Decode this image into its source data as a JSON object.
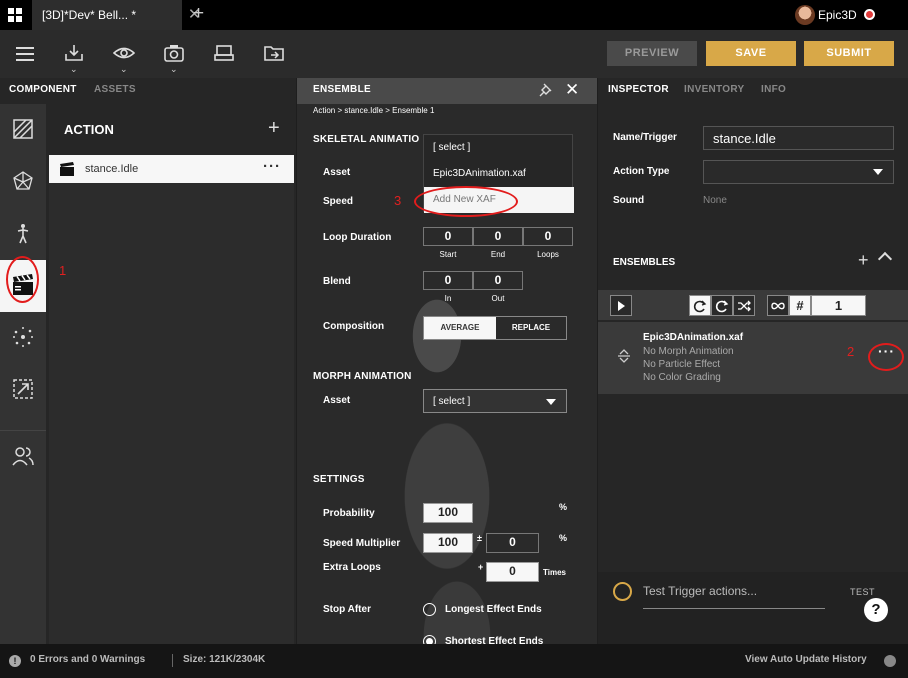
{
  "titlebar": {
    "tab_title": "[3D]*Dev* Bell... *",
    "user": "Epic3D"
  },
  "toolbar": {
    "preview": "PREVIEW",
    "save": "SAVE",
    "submit": "SUBMIT"
  },
  "left": {
    "tabs": [
      "COMPONENT",
      "ASSETS"
    ],
    "section_title": "ACTION",
    "items": [
      {
        "label": "stance.Idle"
      }
    ]
  },
  "annotations": {
    "one": "1",
    "two": "2",
    "three": "3"
  },
  "ensemble": {
    "title": "ENSEMBLE",
    "breadcrumb": "Action > stance.Idle > Ensemble 1",
    "skeletal_title": "SKELETAL ANIMATIO",
    "asset_label": "Asset",
    "speed_label": "Speed",
    "dropdown_items": [
      "[ select ]",
      "Epic3DAnimation.xaf",
      "Add New XAF"
    ],
    "loop_label": "Loop Duration",
    "loop": {
      "start": "0",
      "end": "0",
      "loops": "0",
      "start_lbl": "Start",
      "end_lbl": "End",
      "loops_lbl": "Loops"
    },
    "blend_label": "Blend",
    "blend": {
      "in": "0",
      "out": "0",
      "in_lbl": "In",
      "out_lbl": "Out"
    },
    "composition_label": "Composition",
    "composition": {
      "average": "AVERAGE",
      "replace": "REPLACE"
    },
    "morph_title": "MORPH ANIMATION",
    "morph_asset_label": "Asset",
    "morph_select": "[ select ]",
    "settings_title": "SETTINGS",
    "probability_label": "Probability",
    "probability": "100",
    "probability_unit": "%",
    "speed_mult_label": "Speed Multiplier",
    "speed_mult": "100",
    "speed_mult_pm": "±",
    "speed_mult_var": "0",
    "speed_mult_unit": "%",
    "extra_loops_label": "Extra Loops",
    "extra_loops_plus": "+",
    "extra_loops": "0",
    "extra_loops_unit": "Times",
    "stop_after_label": "Stop After",
    "stop_options": [
      "Longest Effect Ends",
      "Shortest Effect Ends"
    ]
  },
  "inspector": {
    "tabs": [
      "INSPECTOR",
      "INVENTORY",
      "INFO"
    ],
    "name_label": "Name/Trigger",
    "name_value": "stance.Idle",
    "action_type_label": "Action Type",
    "sound_label": "Sound",
    "sound_value": "None",
    "ensembles_title": "ENSEMBLES",
    "loop_count": "1",
    "hash": "#",
    "item": {
      "title": "Epic3DAnimation.xaf",
      "lines": [
        "No Morph Animation",
        "No Particle Effect",
        "No Color Grading"
      ]
    },
    "test_placeholder": "Test Trigger actions...",
    "test_label": "TEST",
    "help": "?"
  },
  "status": {
    "errors": "0 Errors and 0 Warnings",
    "size": "Size: 121K/2304K",
    "history": "View Auto Update History"
  },
  "colors": {
    "accent": "#d8a848",
    "annotation": "#e21c1c"
  }
}
